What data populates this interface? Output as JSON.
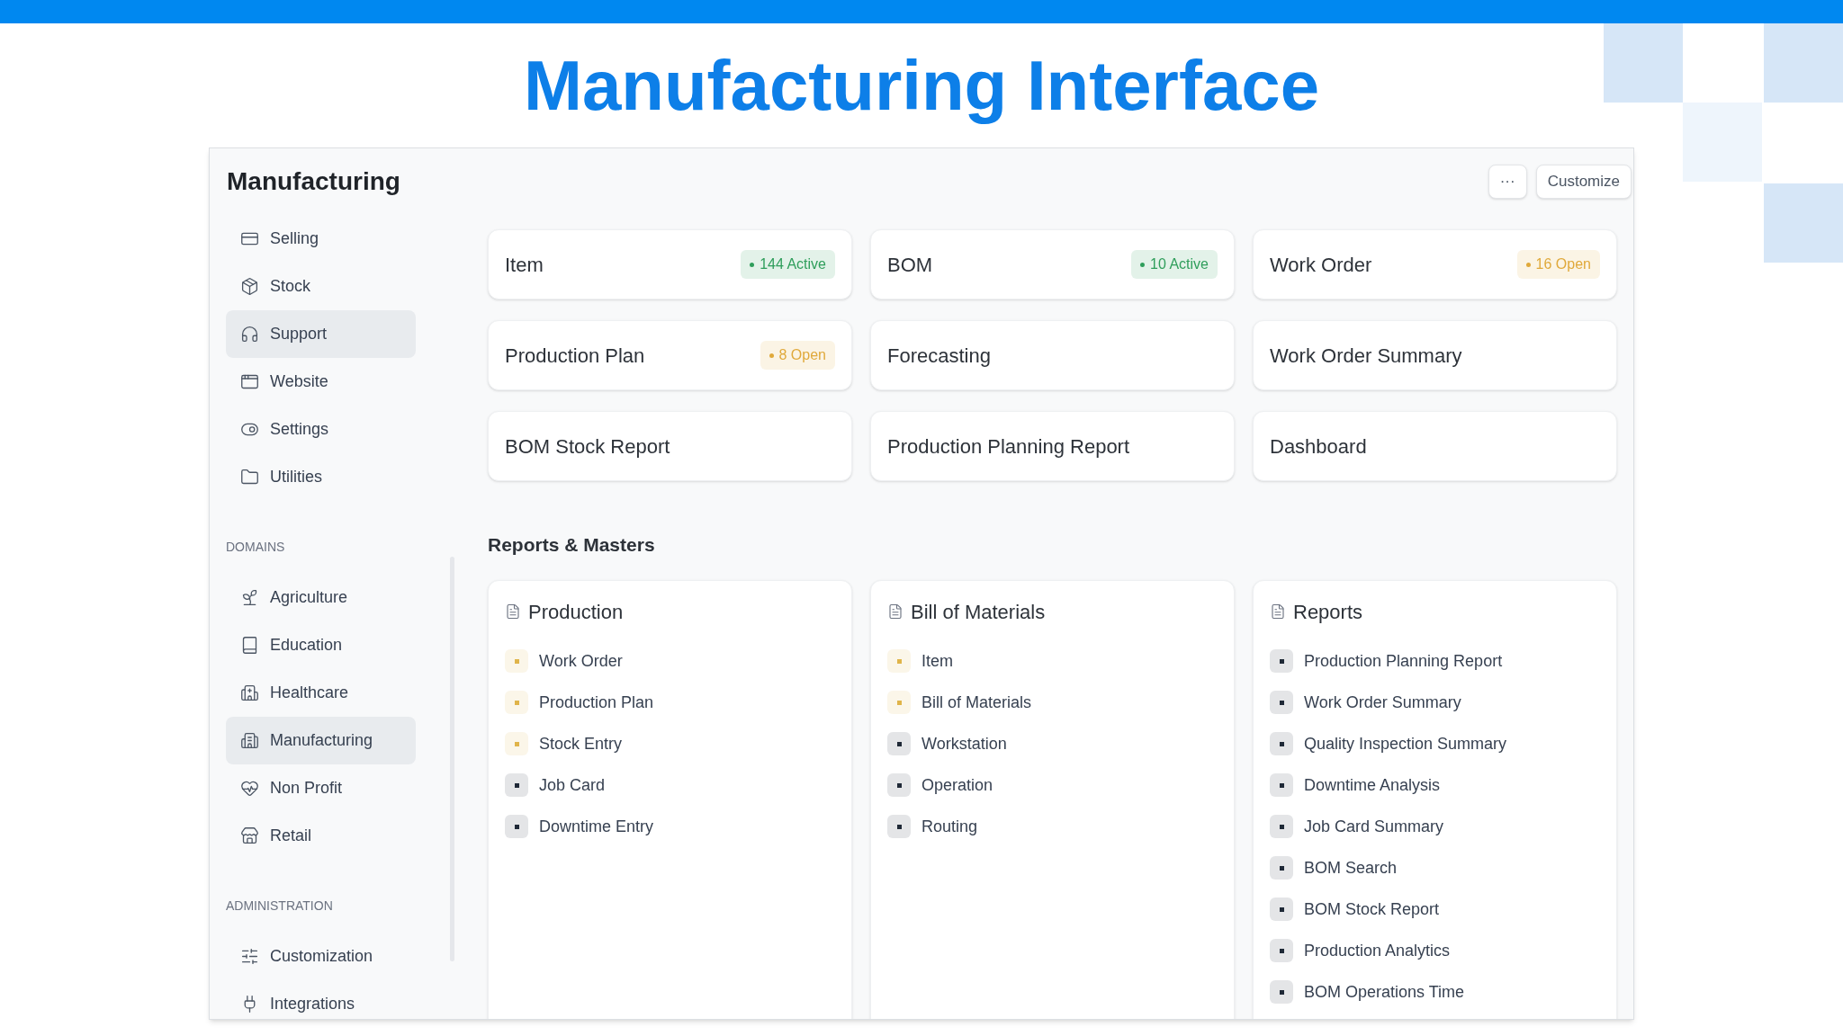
{
  "slide_title": "Manufacturing Interface",
  "page": {
    "title": "Manufacturing",
    "buttons": [
      "···",
      "Customize"
    ]
  },
  "sidebar": {
    "sections": [
      {
        "items": [
          {
            "label": "Selling",
            "selected": false
          },
          {
            "label": "Stock",
            "selected": false
          },
          {
            "label": "Support",
            "selected": true
          },
          {
            "label": "Website",
            "selected": false
          },
          {
            "label": "Settings",
            "selected": false
          },
          {
            "label": "Utilities",
            "selected": false
          }
        ]
      },
      {
        "heading": "DOMAINS",
        "items": [
          {
            "label": "Agriculture",
            "selected": false
          },
          {
            "label": "Education",
            "selected": false
          },
          {
            "label": "Healthcare",
            "selected": false
          },
          {
            "label": "Manufacturing",
            "selected": true
          },
          {
            "label": "Non Profit",
            "selected": false
          },
          {
            "label": "Retail",
            "selected": false
          }
        ]
      },
      {
        "heading": "ADMINISTRATION",
        "items": [
          {
            "label": "Customization",
            "selected": false
          },
          {
            "label": "Integrations",
            "selected": false
          }
        ]
      }
    ]
  },
  "shortcuts": [
    {
      "label": "Item",
      "badge": {
        "text": "144 Active",
        "color": "#2f9e5b"
      }
    },
    {
      "label": "BOM",
      "badge": {
        "text": "10 Active",
        "color": "#2f9e5b"
      }
    },
    {
      "label": "Work Order",
      "badge": {
        "text": "16 Open",
        "color": "#e0a93b"
      }
    },
    {
      "label": "Production Plan",
      "badge": {
        "text": "8 Open",
        "color": "#e0a93b"
      }
    },
    {
      "label": "Forecasting"
    },
    {
      "label": "Work Order Summary"
    },
    {
      "label": "BOM Stock Report"
    },
    {
      "label": "Production Planning Report"
    },
    {
      "label": "Dashboard"
    }
  ],
  "reports_masters": {
    "title": "Reports & Masters",
    "cards": [
      {
        "title": "Production",
        "links": [
          {
            "label": "Work Order",
            "color": "#e0b44a"
          },
          {
            "label": "Production Plan",
            "color": "#e0b44a"
          },
          {
            "label": "Stock Entry",
            "color": "#e0b44a"
          },
          {
            "label": "Job Card",
            "color": "#1f2937"
          },
          {
            "label": "Downtime Entry",
            "color": "#1f2937"
          }
        ]
      },
      {
        "title": "Bill of Materials",
        "links": [
          {
            "label": "Item",
            "color": "#e0b44a"
          },
          {
            "label": "Bill of Materials",
            "color": "#e0b44a"
          },
          {
            "label": "Workstation",
            "color": "#1f2937"
          },
          {
            "label": "Operation",
            "color": "#1f2937"
          },
          {
            "label": "Routing",
            "color": "#1f2937"
          }
        ]
      },
      {
        "title": "Reports",
        "links": [
          {
            "label": "Production Planning Report",
            "color": "#1f2937"
          },
          {
            "label": "Work Order Summary",
            "color": "#1f2937"
          },
          {
            "label": "Quality Inspection Summary",
            "color": "#1f2937"
          },
          {
            "label": "Downtime Analysis",
            "color": "#1f2937"
          },
          {
            "label": "Job Card Summary",
            "color": "#1f2937"
          },
          {
            "label": "BOM Search",
            "color": "#1f2937"
          },
          {
            "label": "BOM Stock Report",
            "color": "#1f2937"
          },
          {
            "label": "Production Analytics",
            "color": "#1f2937"
          },
          {
            "label": "BOM Operations Time",
            "color": "#1f2937"
          }
        ]
      }
    ]
  }
}
